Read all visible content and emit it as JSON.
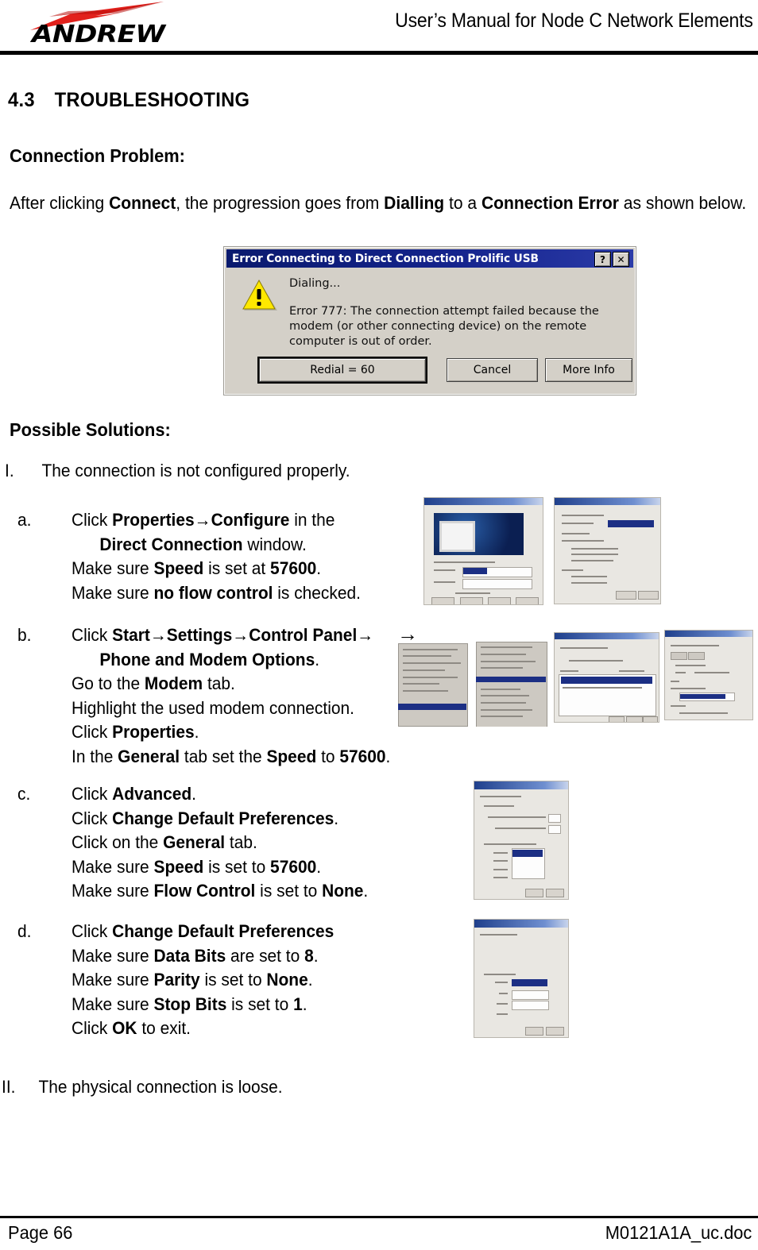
{
  "header": {
    "logo_text": "ANDREW",
    "title": "User’s Manual for Node C Network Elements"
  },
  "section": {
    "number": "4.3",
    "title": "TROUBLESHOOTING"
  },
  "connection_problem": {
    "heading": "Connection Problem:",
    "intro_part1": "After clicking ",
    "intro_bold1": "Connect",
    "intro_part2": ", the progression goes from ",
    "intro_bold2": "Dialling",
    "intro_part3": " to a ",
    "intro_bold3": "Connection Error",
    "intro_part4": " as shown below."
  },
  "error_dialog": {
    "title": "Error Connecting to Direct Connection Prolific USB",
    "help_button": "?",
    "close_button": "✕",
    "status_text": "Dialing...",
    "error_text": "Error 777: The connection attempt failed because the modem (or other connecting device) on the remote computer is out of order.",
    "buttons": {
      "redial": "Redial = 60",
      "cancel": "Cancel",
      "more_info": "More Info"
    },
    "title_bar_color": "#14238c",
    "face_color": "#d4d0c8",
    "warning_color": "#ffe800"
  },
  "solutions": {
    "heading": "Possible Solutions:",
    "items": [
      {
        "marker": "I.",
        "text": "The connection is not configured properly."
      },
      {
        "marker": "II.",
        "text": "The physical connection is loose."
      }
    ],
    "steps": [
      {
        "marker": "a.",
        "lines": [
          {
            "indent": false,
            "parts": [
              {
                "t": "Click ",
                "b": false
              },
              {
                "t": "Properties",
                "b": true
              },
              {
                "t": "→",
                "b": true
              },
              {
                "t": "Configure",
                "b": true
              },
              {
                "t": " in the",
                "b": false
              }
            ]
          },
          {
            "indent": true,
            "parts": [
              {
                "t": "Direct Connection",
                "b": true
              },
              {
                "t": " window.",
                "b": false
              }
            ]
          },
          {
            "indent": false,
            "parts": [
              {
                "t": "Make sure ",
                "b": false
              },
              {
                "t": "Speed",
                "b": true
              },
              {
                "t": " is set at ",
                "b": false
              },
              {
                "t": "57600",
                "b": true
              },
              {
                "t": ".",
                "b": false
              }
            ]
          },
          {
            "indent": false,
            "parts": [
              {
                "t": "Make sure ",
                "b": false
              },
              {
                "t": "no flow control",
                "b": true
              },
              {
                "t": " is checked.",
                "b": false
              }
            ]
          }
        ]
      },
      {
        "marker": "b.",
        "lines": [
          {
            "indent": false,
            "parts": [
              {
                "t": "Click ",
                "b": false
              },
              {
                "t": "Start",
                "b": true
              },
              {
                "t": "→",
                "b": true
              },
              {
                "t": "Settings",
                "b": true
              },
              {
                "t": "→",
                "b": true
              },
              {
                "t": "Control Panel",
                "b": true
              },
              {
                "t": "→",
                "b": true
              }
            ]
          },
          {
            "indent": true,
            "parts": [
              {
                "t": "Phone and Modem Options",
                "b": true
              },
              {
                "t": ".",
                "b": false
              }
            ]
          },
          {
            "indent": false,
            "parts": [
              {
                "t": "Go to the ",
                "b": false
              },
              {
                "t": "Modem",
                "b": true
              },
              {
                "t": " tab.",
                "b": false
              }
            ]
          },
          {
            "indent": false,
            "parts": [
              {
                "t": "Highlight the used modem connection.",
                "b": false
              }
            ]
          },
          {
            "indent": false,
            "parts": [
              {
                "t": "Click ",
                "b": false
              },
              {
                "t": "Properties",
                "b": true
              },
              {
                "t": ".",
                "b": false
              }
            ]
          },
          {
            "indent": false,
            "parts": [
              {
                "t": "In the ",
                "b": false
              },
              {
                "t": "General",
                "b": true
              },
              {
                "t": " tab set the ",
                "b": false
              },
              {
                "t": "Speed",
                "b": true
              },
              {
                "t": " to ",
                "b": false
              },
              {
                "t": "57600",
                "b": true
              },
              {
                "t": ".",
                "b": false
              }
            ]
          }
        ]
      },
      {
        "marker": "c.",
        "lines": [
          {
            "indent": false,
            "parts": [
              {
                "t": "Click ",
                "b": false
              },
              {
                "t": "Advanced",
                "b": true
              },
              {
                "t": ".",
                "b": false
              }
            ]
          },
          {
            "indent": false,
            "parts": [
              {
                "t": "Click ",
                "b": false
              },
              {
                "t": "Change Default Preferences",
                "b": true
              },
              {
                "t": ".",
                "b": false
              }
            ]
          },
          {
            "indent": false,
            "parts": [
              {
                "t": "Click on the ",
                "b": false
              },
              {
                "t": "General",
                "b": true
              },
              {
                "t": " tab.",
                "b": false
              }
            ]
          },
          {
            "indent": false,
            "parts": [
              {
                "t": "Make sure ",
                "b": false
              },
              {
                "t": "Speed",
                "b": true
              },
              {
                "t": " is set to ",
                "b": false
              },
              {
                "t": "57600",
                "b": true
              },
              {
                "t": ".",
                "b": false
              }
            ]
          },
          {
            "indent": false,
            "parts": [
              {
                "t": "Make sure ",
                "b": false
              },
              {
                "t": "Flow Control",
                "b": true
              },
              {
                "t": " is set to ",
                "b": false
              },
              {
                "t": "None",
                "b": true
              },
              {
                "t": ".",
                "b": false
              }
            ]
          }
        ]
      },
      {
        "marker": "d.",
        "lines": [
          {
            "indent": false,
            "parts": [
              {
                "t": "Click ",
                "b": false
              },
              {
                "t": "Change Default Preferences",
                "b": true
              }
            ]
          },
          {
            "indent": false,
            "parts": [
              {
                "t": "Make sure ",
                "b": false
              },
              {
                "t": "Data Bits",
                "b": true
              },
              {
                "t": " are set to ",
                "b": false
              },
              {
                "t": "8",
                "b": true
              },
              {
                "t": ".",
                "b": false
              }
            ]
          },
          {
            "indent": false,
            "parts": [
              {
                "t": "Make sure ",
                "b": false
              },
              {
                "t": "Parity",
                "b": true
              },
              {
                "t": " is set to ",
                "b": false
              },
              {
                "t": "None",
                "b": true
              },
              {
                "t": ".",
                "b": false
              }
            ]
          },
          {
            "indent": false,
            "parts": [
              {
                "t": "Make sure ",
                "b": false
              },
              {
                "t": "Stop Bits",
                "b": true
              },
              {
                "t": " is set to ",
                "b": false
              },
              {
                "t": "1",
                "b": true
              },
              {
                "t": ".",
                "b": false
              }
            ]
          },
          {
            "indent": false,
            "parts": [
              {
                "t": "Click ",
                "b": false
              },
              {
                "t": "OK",
                "b": true
              },
              {
                "t": " to exit.",
                "b": false
              }
            ]
          }
        ]
      }
    ]
  },
  "thumbnails": {
    "arrow_glyph": "→",
    "captions": [
      "direct-connection-window",
      "connection-properties-dialog",
      "start-menu-control-panel-cascade",
      "phone-and-modem-options-dialog",
      "modem-general-tab-dialog",
      "advanced-change-default-preferences-dialog",
      "change-default-preferences-dialog"
    ]
  },
  "footer": {
    "page": "Page 66",
    "document": "M0121A1A_uc.doc"
  }
}
